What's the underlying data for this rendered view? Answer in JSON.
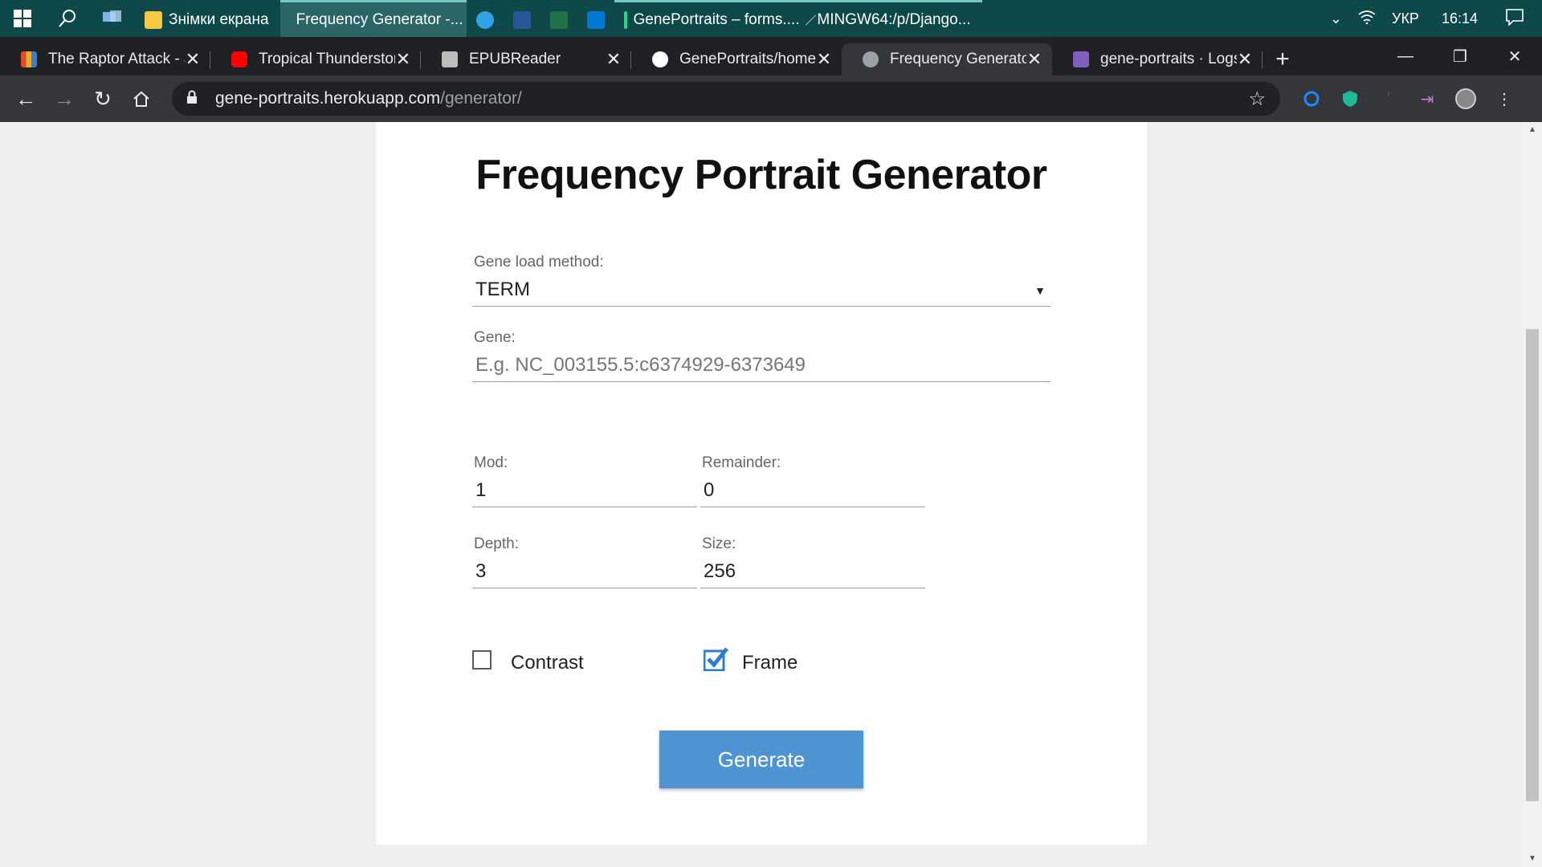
{
  "taskbar": {
    "apps": [
      {
        "label": "Знімки екрана",
        "icon": "folder-icon",
        "color": "#f6c846"
      },
      {
        "label": "Frequency Generator -...",
        "icon": "chrome-icon",
        "color": "#db4437"
      },
      {
        "label": "",
        "icon": "edge-icon",
        "color": "#2fa3e6"
      },
      {
        "label": "",
        "icon": "word-icon",
        "color": "#2b579a"
      },
      {
        "label": "",
        "icon": "excel-icon",
        "color": "#217346"
      },
      {
        "label": "",
        "icon": "outlook-icon",
        "color": "#0078d4"
      },
      {
        "label": "GenePortraits – forms....",
        "icon": "pycharm-icon",
        "color": "#21d789"
      },
      {
        "label": "MINGW64:/p/Django...",
        "icon": "git-bash-icon",
        "color": "#e0e0e0"
      }
    ],
    "tray": {
      "language": "УКР",
      "time": "16:14"
    }
  },
  "tabs": [
    {
      "title": "The Raptor Attack - J",
      "icon": "raptor-favicon",
      "color": "#e3b02a",
      "active": false
    },
    {
      "title": "Tropical Thunderstorm",
      "icon": "youtube-favicon",
      "color": "#ff0000",
      "active": false
    },
    {
      "title": "EPUBReader",
      "icon": "book-favicon",
      "color": "#bdbdbd",
      "active": false
    },
    {
      "title": "GenePortraits/home",
      "icon": "github-favicon",
      "color": "#ffffff",
      "active": false
    },
    {
      "title": "Frequency Generator",
      "icon": "globe-favicon",
      "color": "#9aa0a6",
      "active": true
    },
    {
      "title": "gene-portraits · Logs",
      "icon": "heroku-favicon",
      "color": "#7f5fbf",
      "active": false
    }
  ],
  "address": {
    "host": "gene-portraits.herokuapp.com",
    "path": "/generator/"
  },
  "form": {
    "title": "Frequency Portrait Generator",
    "load_method": {
      "label": "Gene load method:",
      "value": "TERM"
    },
    "gene": {
      "label": "Gene:",
      "placeholder": "E.g. NC_003155.5:c6374929-6373649"
    },
    "mod": {
      "label": "Mod:",
      "value": "1"
    },
    "remainder": {
      "label": "Remainder:",
      "value": "0"
    },
    "depth": {
      "label": "Depth:",
      "value": "3"
    },
    "size": {
      "label": "Size:",
      "value": "256"
    },
    "contrast": {
      "label": "Contrast",
      "checked": false
    },
    "frame": {
      "label": "Frame",
      "checked": true
    },
    "generate_label": "Generate"
  },
  "colors": {
    "button": "#4f94d2",
    "checkbox_checked": "#2e7ec9",
    "taskbar": "#0e4849"
  }
}
